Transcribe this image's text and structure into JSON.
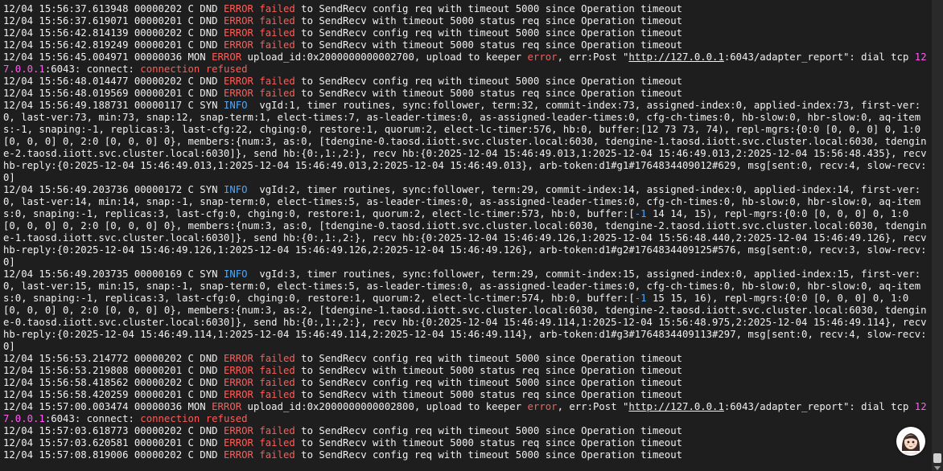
{
  "colors": {
    "error": "#ff5c57",
    "info": "#4aa8ff",
    "ip": "#ff5cf4"
  },
  "lines": [
    [
      {
        "t": "12/04 15:56:37.613948 00000202 C DND "
      },
      {
        "t": "ERROR failed",
        "c": "err"
      },
      {
        "t": " to SendRecv config req with timeout 5000 since Operation timeout"
      }
    ],
    [
      {
        "t": "12/04 15:56:37.619071 00000201 C DND "
      },
      {
        "t": "ERROR failed",
        "c": "err"
      },
      {
        "t": " to SendRecv with timeout 5000 status req since Operation timeout"
      }
    ],
    [
      {
        "t": "12/04 15:56:42.814139 00000202 C DND "
      },
      {
        "t": "ERROR failed",
        "c": "err"
      },
      {
        "t": " to SendRecv config req with timeout 5000 since Operation timeout"
      }
    ],
    [
      {
        "t": "12/04 15:56:42.819249 00000201 C DND "
      },
      {
        "t": "ERROR failed",
        "c": "err"
      },
      {
        "t": " to SendRecv with timeout 5000 status req since Operation timeout"
      }
    ],
    [
      {
        "t": "12/04 15:56:45.004971 00000036 MON "
      },
      {
        "t": "ERROR",
        "c": "err"
      },
      {
        "t": " upload_id:0x2000000000002700, upload to keeper "
      },
      {
        "t": "error",
        "c": "err"
      },
      {
        "t": ", err:Post \""
      },
      {
        "t": "http://127.0.0.1",
        "c": "link"
      },
      {
        "t": ":6043/adapter_report\": dial tcp "
      },
      {
        "t": "127.0.0.1",
        "c": "mag"
      },
      {
        "t": ":6043: connect: "
      },
      {
        "t": "connection refused",
        "c": "err"
      }
    ],
    [
      {
        "t": "12/04 15:56:48.014477 00000202 C DND "
      },
      {
        "t": "ERROR failed",
        "c": "err"
      },
      {
        "t": " to SendRecv config req with timeout 5000 since Operation timeout"
      }
    ],
    [
      {
        "t": "12/04 15:56:48.019569 00000201 C DND "
      },
      {
        "t": "ERROR failed",
        "c": "err"
      },
      {
        "t": " to SendRecv with timeout 5000 status req since Operation timeout"
      }
    ],
    [
      {
        "t": "12/04 15:56:49.188731 00000117 C SYN "
      },
      {
        "t": "INFO",
        "c": "info"
      },
      {
        "t": "  vgId:1, timer routines, sync:follower, term:32, commit-index:73, assigned-index:0, applied-index:73, first-ver:0, last-ver:73, min:73, snap:12, snap-term:1, elect-times:7, as-leader-times:0, as-assigned-leader-times:0, cfg-ch-times:0, hb-slow:0, hbr-slow:0, aq-items:-1, snaping:-1, replicas:3, last-cfg:22, chging:0, restore:1, quorum:2, elect-lc-timer:576, hb:0, buffer:[12 73 73, 74), repl-mgrs:{0:0 [0, 0, 0] 0, 1:0 [0, 0, 0] 0, 2:0 [0, 0, 0] 0}, members:{num:3, as:0, [tdengine-0.taosd.iiott.svc.cluster.local:6030, tdengine-1.taosd.iiott.svc.cluster.local:6030, tdengine-2.taosd.iiott.svc.cluster.local:6030]}, send hb:{0:,1:,2:}, recv hb:{0:2025-12-04 15:46:49.013,1:2025-12-04 15:46:49.013,2:2025-12-04 15:56:48.435}, recv hb-reply:{0:2025-12-04 15:46:49.013,1:2025-12-04 15:46:49.013,2:2025-12-04 15:46:49.013}, arb-token:d1#g1#1764834409012#629, msg[sent:0, recv:4, slow-recv:0]"
      }
    ],
    [
      {
        "t": "12/04 15:56:49.203736 00000172 C SYN "
      },
      {
        "t": "INFO",
        "c": "info"
      },
      {
        "t": "  vgId:2, timer routines, sync:follower, term:29, commit-index:14, assigned-index:0, applied-index:14, first-ver:0, last-ver:14, min:14, snap:-1, snap-term:0, elect-times:5, as-leader-times:0, as-assigned-leader-times:0, cfg-ch-times:0, hb-slow:0, hbr-slow:0, aq-items:0, snaping:-1, replicas:3, last-cfg:0, chging:0, restore:1, quorum:2, elect-lc-timer:573, hb:0, buffer:["
      },
      {
        "t": "-1",
        "c": "info"
      },
      {
        "t": " 14 14, 15), repl-mgrs:{0:0 [0, 0, 0] 0, 1:0 [0, 0, 0] 0, 2:0 [0, 0, 0] 0}, members:{num:3, as:0, [tdengine-0.taosd.iiott.svc.cluster.local:6030, tdengine-2.taosd.iiott.svc.cluster.local:6030, tdengine-1.taosd.iiott.svc.cluster.local:6030]}, send hb:{0:,1:,2:}, recv hb:{0:2025-12-04 15:46:49.126,1:2025-12-04 15:56:48.440,2:2025-12-04 15:46:49.126}, recv hb-reply:{0:2025-12-04 15:46:49.126,1:2025-12-04 15:46:49.126,2:2025-12-04 15:46:49.126}, arb-token:d1#g2#1764834409125#576, msg[sent:0, recv:3, slow-recv:0]"
      }
    ],
    [
      {
        "t": "12/04 15:56:49.203735 00000169 C SYN "
      },
      {
        "t": "INFO",
        "c": "info"
      },
      {
        "t": "  vgId:3, timer routines, sync:follower, term:29, commit-index:15, assigned-index:0, applied-index:15, first-ver:0, last-ver:15, min:15, snap:-1, snap-term:0, elect-times:5, as-leader-times:0, as-assigned-leader-times:0, cfg-ch-times:0, hb-slow:0, hbr-slow:0, aq-items:0, snaping:-1, replicas:3, last-cfg:0, chging:0, restore:1, quorum:2, elect-lc-timer:574, hb:0, buffer:["
      },
      {
        "t": "-1",
        "c": "info"
      },
      {
        "t": " 15 15, 16), repl-mgrs:{0:0 [0, 0, 0] 0, 1:0 [0, 0, 0] 0, 2:0 [0, 0, 0] 0}, members:{num:3, as:2, [tdengine-1.taosd.iiott.svc.cluster.local:6030, tdengine-2.taosd.iiott.svc.cluster.local:6030, tdengine-0.taosd.iiott.svc.cluster.local:6030]}, send hb:{0:,1:,2:}, recv hb:{0:2025-12-04 15:46:49.114,1:2025-12-04 15:56:48.975,2:2025-12-04 15:46:49.114}, recv hb-reply:{0:2025-12-04 15:46:49.114,1:2025-12-04 15:46:49.114,2:2025-12-04 15:46:49.114}, arb-token:d1#g3#1764834409113#297, msg[sent:0, recv:4, slow-recv:0]"
      }
    ],
    [
      {
        "t": "12/04 15:56:53.214772 00000202 C DND "
      },
      {
        "t": "ERROR failed",
        "c": "err"
      },
      {
        "t": " to SendRecv config req with timeout 5000 since Operation timeout"
      }
    ],
    [
      {
        "t": "12/04 15:56:53.219808 00000201 C DND "
      },
      {
        "t": "ERROR failed",
        "c": "err"
      },
      {
        "t": " to SendRecv with timeout 5000 status req since Operation timeout"
      }
    ],
    [
      {
        "t": "12/04 15:56:58.418562 00000202 C DND "
      },
      {
        "t": "ERROR failed",
        "c": "err"
      },
      {
        "t": " to SendRecv config req with timeout 5000 since Operation timeout"
      }
    ],
    [
      {
        "t": "12/04 15:56:58.420259 00000201 C DND "
      },
      {
        "t": "ERROR failed",
        "c": "err"
      },
      {
        "t": " to SendRecv with timeout 5000 status req since Operation timeout"
      }
    ],
    [
      {
        "t": "12/04 15:57:00.003474 00000036 MON "
      },
      {
        "t": "ERROR",
        "c": "err"
      },
      {
        "t": " upload_id:0x2000000000002800, upload to keeper "
      },
      {
        "t": "error",
        "c": "err"
      },
      {
        "t": ", err:Post \""
      },
      {
        "t": "http://127.0.0.1",
        "c": "link"
      },
      {
        "t": ":6043/adapter_report\": dial tcp "
      },
      {
        "t": "127.0.0.1",
        "c": "mag"
      },
      {
        "t": ":6043: connect: "
      },
      {
        "t": "connection refused",
        "c": "err"
      }
    ],
    [
      {
        "t": "12/04 15:57:03.618773 00000202 C DND "
      },
      {
        "t": "ERROR failed",
        "c": "err"
      },
      {
        "t": " to SendRecv config req with timeout 5000 since Operation timeout"
      }
    ],
    [
      {
        "t": "12/04 15:57:03.620581 00000201 C DND "
      },
      {
        "t": "ERROR failed",
        "c": "err"
      },
      {
        "t": " to SendRecv with timeout 5000 status req since Operation timeout"
      }
    ],
    [
      {
        "t": "12/04 15:57:08.819006 00000202 C DND "
      },
      {
        "t": "ERROR failed",
        "c": "err"
      },
      {
        "t": " to SendRecv config req with timeout 5000 since Operation timeout"
      }
    ]
  ],
  "avatar": {
    "icon": "girl-avatar-icon"
  },
  "scrollbar": {
    "icon": "scroll-down-arrow-icon"
  }
}
